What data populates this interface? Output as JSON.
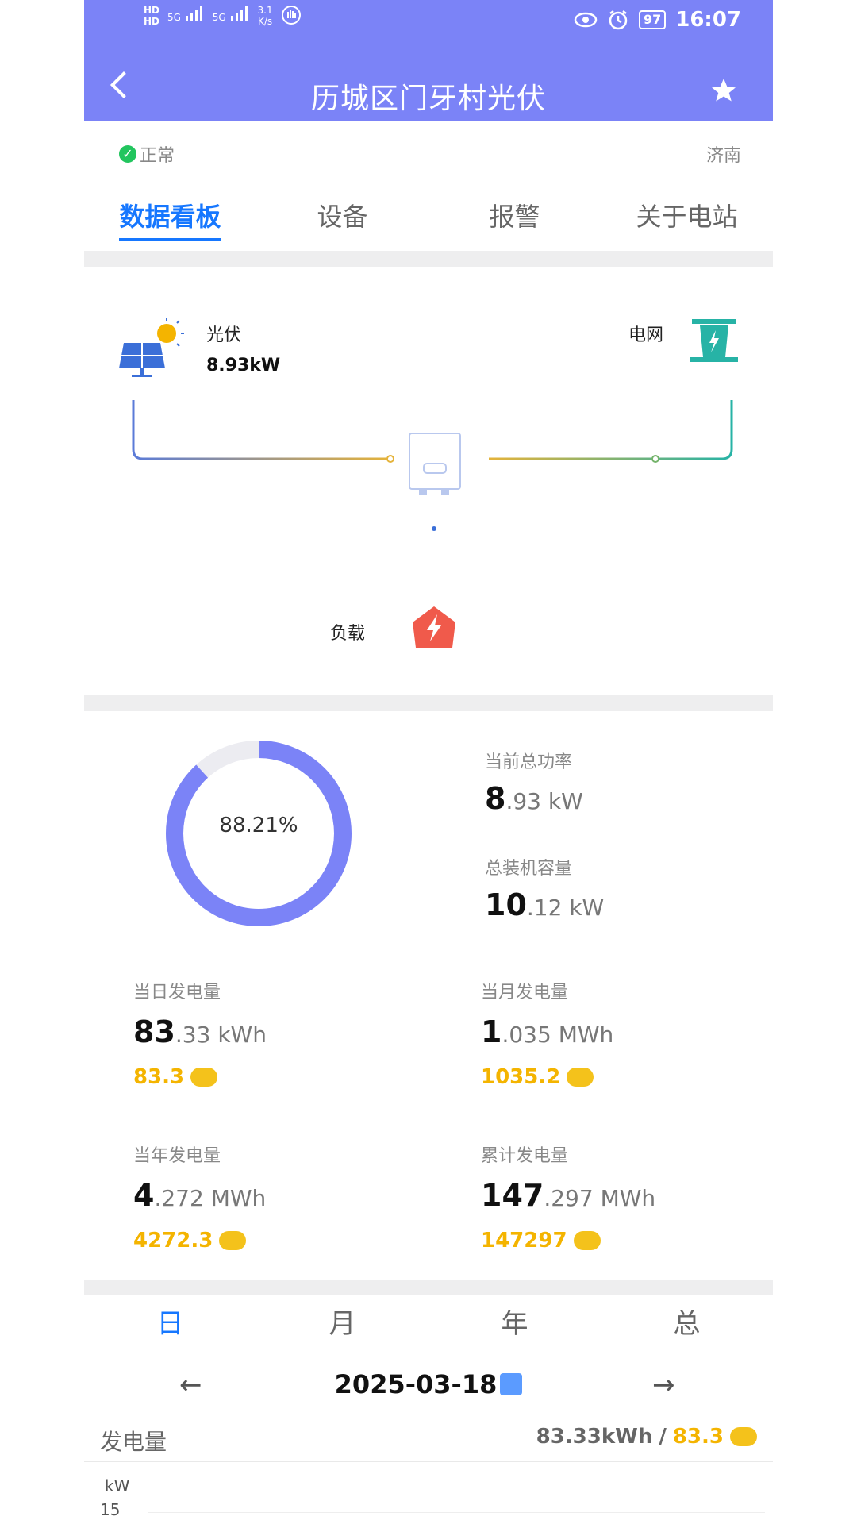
{
  "status_bar": {
    "hd1": "HD",
    "hd2": "HD",
    "sig1": "5G",
    "sig2": "5G",
    "net_speed": "3.1",
    "net_unit": "K/s",
    "battery": "97",
    "time": "16:07"
  },
  "header": {
    "title": "历城区门牙村光伏"
  },
  "station": {
    "status": "正常",
    "city": "济南"
  },
  "tabs": [
    "数据看板",
    "设备",
    "报警",
    "关于电站"
  ],
  "flow": {
    "pv_label": "光伏",
    "pv_value": "8.93kW",
    "grid_label": "电网",
    "load_label": "负载"
  },
  "stats": {
    "donut_percent_text": "88.21%",
    "donut_fraction": 0.8821,
    "current_power": {
      "label": "当前总功率",
      "big": "8",
      "small": ".93 kW"
    },
    "capacity": {
      "label": "总装机容量",
      "big": "10",
      "small": ".12 kW"
    },
    "daily": {
      "label": "当日发电量",
      "big": "83",
      "small": ".33 kWh",
      "money": "83.3"
    },
    "monthly": {
      "label": "当月发电量",
      "big": "1",
      "small": ".035 MWh",
      "money": "1035.2"
    },
    "yearly": {
      "label": "当年发电量",
      "big": "4",
      "small": ".272 MWh",
      "money": "4272.3"
    },
    "total": {
      "label": "累计发电量",
      "big": "147",
      "small": ".297 MWh",
      "money": "147297"
    }
  },
  "time_tabs": [
    "日",
    "月",
    "年",
    "总"
  ],
  "date_nav": {
    "prev": "←",
    "date": "2025-03-18",
    "next": "→"
  },
  "generation": {
    "title": "发电量",
    "value": "83.33kWh",
    "sep": "/",
    "money": "83.3",
    "unit": "kW",
    "tick": "15"
  },
  "colors": {
    "header_bg": "#7b83f7",
    "accent": "#1677ff",
    "money": "#f4b400",
    "donut": "#7b83f7",
    "grid": "#27b3a6",
    "load": "#f05a4b"
  }
}
